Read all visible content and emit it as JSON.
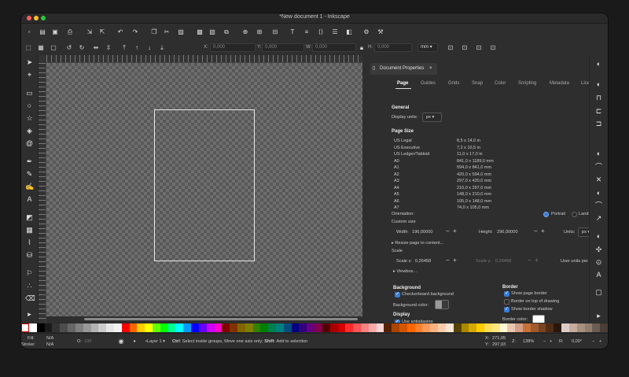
{
  "window": {
    "title": "*New document 1 - Inkscape"
  },
  "colors": {
    "close": "#ff5f57",
    "minimize": "#febc2e",
    "zoom": "#28c840",
    "accent": "#3a7bd5"
  },
  "command_bar": {
    "icons": [
      "new-icon",
      "open-icon",
      "save-icon",
      "print-icon",
      "import-icon",
      "export-icon",
      "undo-icon",
      "redo-icon",
      "copy-icon",
      "cut-icon",
      "paste-icon",
      "group-icon",
      "ungroup-icon",
      "duplicate-icon",
      "zoom-selection-icon",
      "zoom-drawing-icon",
      "zoom-page-icon",
      "text-icon",
      "align-icon",
      "xml-editor-icon",
      "layers-icon",
      "fill-stroke-icon",
      "preferences-icon",
      "document-properties-icon"
    ]
  },
  "controls": {
    "x_label": "X:",
    "x_value": "0,000",
    "y_label": "Y:",
    "y_value": "0,000",
    "w_label": "W:",
    "w_value": "0,000",
    "h_label": "H:",
    "h_value": "0,000",
    "unit": "mm"
  },
  "dock": {
    "tab_label": "Document Properties",
    "tabs": [
      "Page",
      "Guides",
      "Grids",
      "Snap",
      "Color",
      "Scripting",
      "Metadata",
      "License"
    ],
    "general": {
      "heading": "General",
      "display_units_label": "Display units:",
      "display_units": "px"
    },
    "page_size": {
      "heading": "Page Size",
      "rows": [
        {
          "name": "US Legal",
          "size": "8,5 x 14,0 in"
        },
        {
          "name": "US Executive",
          "size": "7,2 x 10,5 in"
        },
        {
          "name": "US Ledger/Tabloid",
          "size": "11,0 x 17,0 in"
        },
        {
          "name": "A0",
          "size": "841,0 x 1189,0 mm"
        },
        {
          "name": "A1",
          "size": "594,0 x 841,0 mm"
        },
        {
          "name": "A2",
          "size": "420,0 x 594,0 mm"
        },
        {
          "name": "A3",
          "size": "297,0 x 420,0 mm"
        },
        {
          "name": "A4",
          "size": "210,0 x 297,0 mm"
        },
        {
          "name": "A5",
          "size": "148,0 x 210,0 mm"
        },
        {
          "name": "A6",
          "size": "105,0 x 148,0 mm"
        },
        {
          "name": "A7",
          "size": "74,0 x 105,0 mm"
        }
      ]
    },
    "orientation": {
      "label": "Orientation:",
      "portrait": "Portrait",
      "landscape": "Landscape"
    },
    "custom_size": {
      "heading": "Custom size",
      "width_label": "Width:",
      "width": "196,00000",
      "height_label": "Height:",
      "height": "296,00000",
      "units_label": "Units:",
      "units": "px"
    },
    "resize_label": "Resize page to content...",
    "scale": {
      "heading": "Scale",
      "scale_x_label": "Scale x:",
      "scale_x": "0,26458",
      "scale_y_label": "Scale y:",
      "scale_y": "0,26458",
      "user_units": "User units per px."
    },
    "viewbox_label": "Viewbox...",
    "background": {
      "heading": "Background",
      "checkerboard": "Checkerboard background",
      "color_label": "Background color:"
    },
    "border": {
      "heading": "Border",
      "show_border": "Show page border",
      "border_on_top": "Border on top of drawing",
      "show_shadow": "Show border shadow",
      "color_label": "Border color:"
    },
    "display": {
      "heading": "Display",
      "antialiasing": "Use antialiasing"
    }
  },
  "status": {
    "fill_label": "Fill:",
    "fill_value": "N/A",
    "stroke_label": "Stroke:",
    "stroke_value": "N/A",
    "opacity_label": "O:",
    "opacity_value": "100",
    "layer": "•Layer 1",
    "message_bold1": "Ctrl",
    "message_1": ": Select inside groups, Move one axis only; ",
    "message_bold2": "Shift",
    "message_2": ": Add to selection",
    "x_label": "X:",
    "x_value": "271,05",
    "y_label": "Y:",
    "y_value": "297,93",
    "zoom_label": "Z:",
    "zoom_value": "138%",
    "rot_label": "R:",
    "rot_value": "0,00°"
  }
}
